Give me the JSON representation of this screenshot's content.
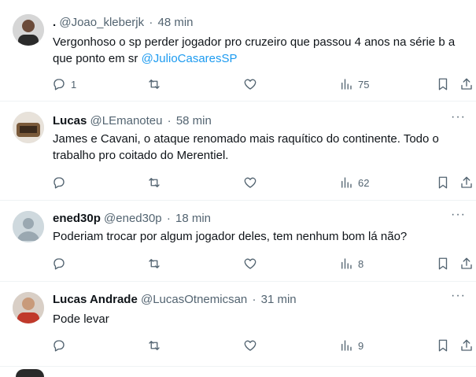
{
  "tweets": [
    {
      "name": ".",
      "handle": "@Joao_kleberjk",
      "time": "48 min",
      "text": "Vergonhoso o sp perder jogador pro cruzeiro que passou 4 anos na série b a que ponto em sr ",
      "mention": "@JulioCasaresSP",
      "replies": "1",
      "retweets": "",
      "likes": "",
      "views": "75",
      "avatar_color": "#3a3a3a"
    },
    {
      "name": "Lucas",
      "handle": "@LEmanoteu",
      "time": "58 min",
      "text": "James e Cavani, o ataque renomado mais raquítico do continente. Todo o trabalho pro coitado do Merentiel.",
      "mention": "",
      "replies": "",
      "retweets": "",
      "likes": "",
      "views": "62",
      "avatar_color": "#7a5a3a"
    },
    {
      "name": "ened30p",
      "handle": "@ened30p",
      "time": "18 min",
      "text": "Poderiam trocar por algum jogador deles, tem nenhum bom lá não?",
      "mention": "",
      "replies": "",
      "retweets": "",
      "likes": "",
      "views": "8",
      "avatar_color": "#cfd9de"
    },
    {
      "name": "Lucas Andrade",
      "handle": "@LucasOtnemicsan",
      "time": "31 min",
      "text": "Pode levar",
      "mention": "",
      "replies": "",
      "retweets": "",
      "likes": "",
      "views": "9",
      "avatar_color": "#c0392b"
    }
  ],
  "icons": {
    "reply": "reply-icon",
    "retweet": "retweet-icon",
    "like": "heart-icon",
    "views": "analytics-icon",
    "bookmark": "bookmark-icon",
    "share": "share-icon",
    "more": "more-icon"
  }
}
